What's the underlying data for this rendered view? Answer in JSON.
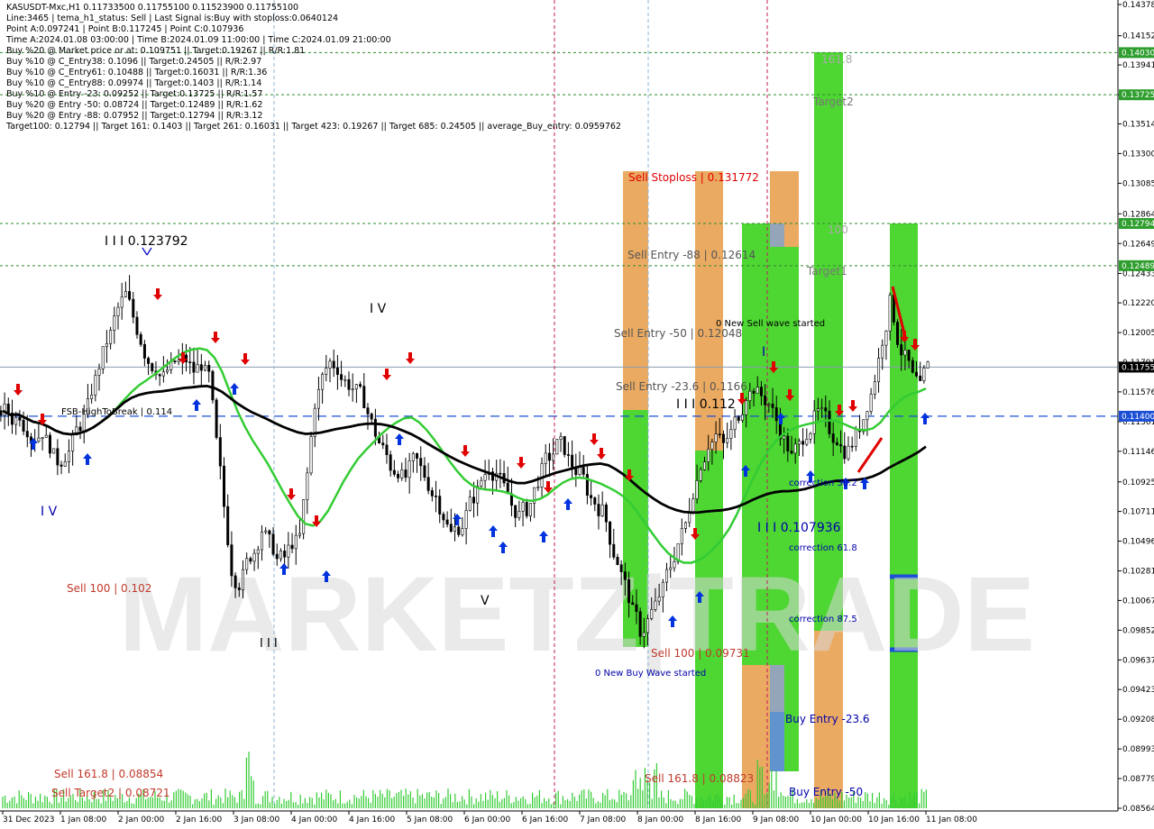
{
  "header": {
    "lines": [
      "KASUSDT-Mxc,H1  0.11733500 0.11755100 0.11523900 0.11755100",
      "Line:3465 | tema_h1_status: Sell | Last Signal is:Buy with stoploss:0.0640124",
      "Point A:0.097241 | Point B:0.117245 | Point C:0.107936",
      "Time A:2024.01.08 03:00:00 | Time B:2024.01.09 11:00:00 | Time C:2024.01.09 21:00:00",
      "Buy %20 @ Market price or at: 0.109751 || Target:0.19267 || R/R:1.81",
      "Buy %10 @ C_Entry38: 0.1096 || Target:0.24505 || R/R:2.97",
      "Buy %10 @ C_Entry61: 0.10488 || Target:0.16031 || R/R:1.36",
      "Buy %10 @ C_Entry88: 0.09974 || Target:0.1403 || R/R:1.14",
      "Buy %10 @ Entry -23: 0.09252 || Target:0.13725 || R/R:1.57",
      "Buy %20 @ Entry -50: 0.08724 || Target:0.12489 || R/R:1.62",
      "Buy %20 @ Entry -88: 0.07952 || Target:0.12794 || R/R:3.12",
      "Target100: 0.12794 || Target 161: 0.1403 || Target 261: 0.16031 || Target 423: 0.19267 || Target 685: 0.24505 || average_Buy_entry: 0.0959762"
    ]
  },
  "watermark": "MARKETZ|TRADE",
  "colors": {
    "price_line": "#4a6fa5",
    "green_zone": "#22cc00",
    "orange_zone": "#e6953a",
    "blue_zone": "#3a78c2",
    "grey_zone": "#7a8fa8",
    "sell_arrow": "#e00000",
    "buy_arrow": "#0033dd",
    "ma_black": "#000000",
    "ma_green": "#33cc33",
    "axis_tag_green": "#2e9e2e",
    "axis_tag_blue": "#1a4fd6",
    "axis_tag_black": "#000000"
  },
  "chart_data": {
    "type": "candlestick",
    "symbol": "KASUSDT-Mxc",
    "timeframe": "H1",
    "ylim": [
      0.08564,
      0.14378
    ],
    "y_ticks": [
      "0.14378",
      "0.14152",
      "0.13941",
      "0.13725",
      "0.13514",
      "0.13300",
      "0.13085",
      "0.12864",
      "0.12649",
      "0.12433",
      "0.12220",
      "0.12005",
      "0.11791",
      "0.11576",
      "0.11361",
      "0.11146",
      "0.10925",
      "0.10711",
      "0.10496",
      "0.10281",
      "0.10067",
      "0.09852",
      "0.09637",
      "0.09423",
      "0.09208",
      "0.08993",
      "0.08779",
      "0.08564"
    ],
    "x_ticks": [
      "31 Dec 2023",
      "1 Jan 08:00",
      "2 Jan 00:00",
      "2 Jan 16:00",
      "3 Jan 08:00",
      "4 Jan 00:00",
      "4 Jan 16:00",
      "5 Jan 08:00",
      "6 Jan 00:00",
      "6 Jan 16:00",
      "7 Jan 08:00",
      "8 Jan 00:00",
      "8 Jan 16:00",
      "9 Jan 08:00",
      "10 Jan 00:00",
      "10 Jan 16:00",
      "11 Jan 08:00"
    ],
    "current_price": "0.11755",
    "price_tags": [
      {
        "value": 0.1403,
        "label": "0.14030",
        "style": "green"
      },
      {
        "value": 0.13725,
        "label": "0.13725",
        "style": "green"
      },
      {
        "value": 0.12794,
        "label": "0.12794",
        "style": "green"
      },
      {
        "value": 0.12489,
        "label": "0.12489",
        "style": "green"
      },
      {
        "value": 0.11755,
        "label": "0.11755",
        "style": "black"
      },
      {
        "value": 0.114,
        "label": "0.11400",
        "style": "blue"
      }
    ],
    "annotations": [
      {
        "text": "I I I 0.123792",
        "color": "#000000"
      },
      {
        "text": "I V",
        "color": "#000000"
      },
      {
        "text": "I V",
        "color": "#0000aa"
      },
      {
        "text": "V",
        "color": "#000000"
      },
      {
        "text": "I I I",
        "color": "#000000"
      },
      {
        "text": "FSB-HighToBreak | 0.114",
        "color": "#000000"
      },
      {
        "text": "Sell 100 | 0.102",
        "color": "#c0392b"
      },
      {
        "text": "Sell 161.8 | 0.08854",
        "color": "#c0392b"
      },
      {
        "text": "Sell Target2 | 0.08721",
        "color": "#c0392b"
      },
      {
        "text": "Sell Stoploss | 0.131772",
        "color": "#e00000"
      },
      {
        "text": "Sell Entry -88 | 0.12614",
        "color": "#555555"
      },
      {
        "text": "Sell Entry -50 | 0.12048",
        "color": "#555555"
      },
      {
        "text": "Sell Entry -23.6 | 0.1166",
        "color": "#555555"
      },
      {
        "text": "Sell 100 | 0.09731",
        "color": "#c0392b"
      },
      {
        "text": "Sell 161.8 | 0.08823",
        "color": "#c0392b"
      },
      {
        "text": "0 New Buy Wave started",
        "color": "#0000aa"
      },
      {
        "text": "0 New Sell wave started",
        "color": "#000000"
      },
      {
        "text": "I I I 0.112",
        "color": "#000000"
      },
      {
        "text": "I",
        "color": "#0000aa"
      },
      {
        "text": "I I I 0.107936",
        "color": "#0000aa"
      },
      {
        "text": "correction 38.2",
        "color": "#0000aa"
      },
      {
        "text": "correction 61.8",
        "color": "#0000aa"
      },
      {
        "text": "correction 87.5",
        "color": "#0000aa"
      },
      {
        "text": "Buy Entry -23.6",
        "color": "#0000aa"
      },
      {
        "text": "Buy Entry -50",
        "color": "#0000aa"
      },
      {
        "text": "161.8",
        "color": "#aaaaaa"
      },
      {
        "text": "Target2",
        "color": "#777777"
      },
      {
        "text": "100",
        "color": "#aaaaaa"
      },
      {
        "text": "Target1",
        "color": "#777777"
      }
    ],
    "close_path": [
      0.1144,
      0.1138,
      0.1142,
      0.1131,
      0.1125,
      0.1129,
      0.1119,
      0.1108,
      0.1112,
      0.1121,
      0.1134,
      0.1147,
      0.1166,
      0.1185,
      0.1199,
      0.1218,
      0.1228,
      0.1212,
      0.1195,
      0.118,
      0.1175,
      0.1168,
      0.1175,
      0.1179,
      0.1181,
      0.1173,
      0.1178,
      0.1169,
      0.1121,
      0.1075,
      0.1029,
      0.1019,
      0.1034,
      0.1042,
      0.1058,
      0.1049,
      0.1036,
      0.1038,
      0.1049,
      0.1053,
      0.1098,
      0.115,
      0.1168,
      0.1179,
      0.1175,
      0.1165,
      0.116,
      0.1156,
      0.1142,
      0.1128,
      0.1116,
      0.1104,
      0.1101,
      0.1096,
      0.1108,
      0.1102,
      0.1091,
      0.1082,
      0.1068,
      0.1055,
      0.106,
      0.1069,
      0.1082,
      0.1094,
      0.1104,
      0.1099,
      0.1088,
      0.1076,
      0.1068,
      0.1073,
      0.1086,
      0.11,
      0.1111,
      0.1119,
      0.1117,
      0.1105,
      0.1098,
      0.1087,
      0.1078,
      0.1071,
      0.1052,
      0.1035,
      0.1018,
      0.0998,
      0.0985,
      0.0992,
      0.1003,
      0.1015,
      0.1032,
      0.1048,
      0.1062,
      0.1086,
      0.1106,
      0.112,
      0.1126,
      0.1119,
      0.1128,
      0.1142,
      0.1156,
      0.1161,
      0.1155,
      0.1149,
      0.1137,
      0.1122,
      0.111,
      0.1119,
      0.1129,
      0.1138,
      0.1141,
      0.1131,
      0.1124,
      0.1115,
      0.1121,
      0.1133,
      0.1149,
      0.1168,
      0.1196,
      0.1222,
      0.1196,
      0.1182,
      0.1168,
      0.116,
      0.1176
    ]
  }
}
